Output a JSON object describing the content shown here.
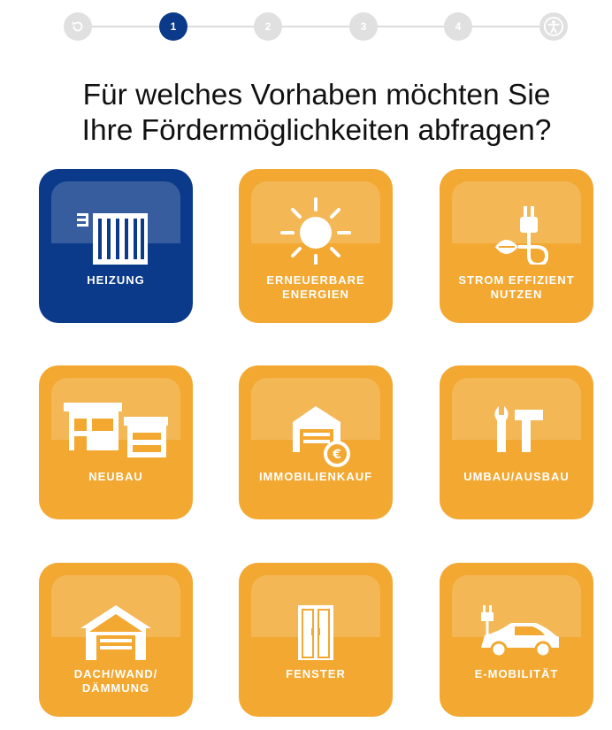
{
  "stepper": {
    "steps": [
      {
        "label": "",
        "icon": "restart-icon"
      },
      {
        "label": "1"
      },
      {
        "label": "2"
      },
      {
        "label": "3"
      },
      {
        "label": "4"
      },
      {
        "label": "",
        "icon": "accessibility-icon"
      }
    ],
    "active_step": 1
  },
  "heading": {
    "line1": "Für welches Vorhaben möchten Sie",
    "line2": "Ihre Fördermöglichkeiten abfragen?"
  },
  "tiles": [
    {
      "label": "HEIZUNG",
      "icon": "radiator-icon",
      "selected": true
    },
    {
      "label": "ERNEUERBARE\nENERGIEN",
      "icon": "sun-icon"
    },
    {
      "label": "STROM EFFIZIENT\nNUTZEN",
      "icon": "plug-leaf-icon"
    },
    {
      "label": "NEUBAU",
      "icon": "new-building-icon"
    },
    {
      "label": "IMMOBILIENKAUF",
      "icon": "house-euro-icon"
    },
    {
      "label": "UMBAU/AUSBAU",
      "icon": "wrench-hammer-icon"
    },
    {
      "label": "DACH/WAND/\nDÄMMUNG",
      "icon": "roof-insulation-icon"
    },
    {
      "label": "FENSTER",
      "icon": "window-icon"
    },
    {
      "label": "E-MOBILITÄT",
      "icon": "electric-car-icon"
    }
  ],
  "colors": {
    "tile": "#f2a831",
    "selected": "#0b3a8a",
    "step_inactive": "#e0e0e0"
  }
}
